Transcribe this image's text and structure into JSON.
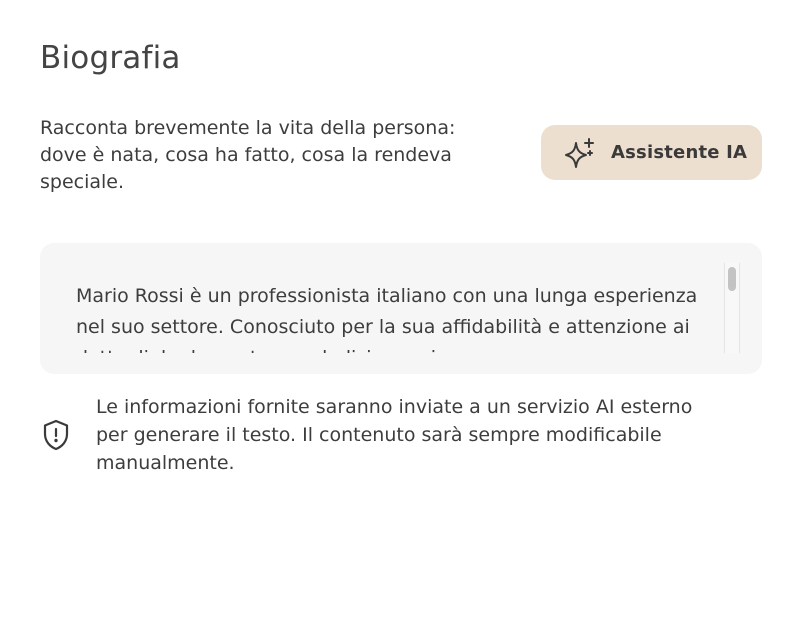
{
  "section": {
    "title": "Biografia",
    "description": "Racconta brevemente la vita della persona:\ndove è nata, cosa ha fatto, cosa la rendeva\nspeciale."
  },
  "ai_button": {
    "label": "Assistente IA",
    "icon": "sparkles-icon"
  },
  "biography_field": {
    "value": "Mario Rossi è un professionista italiano con una lunga esperienza nel suo settore. Conosciuto per la sua affidabilità e attenzione ai dettagli, ha lavorato con dedizione e impegno."
  },
  "notice": {
    "icon": "shield-alert-icon",
    "text": "Le informazioni fornite saranno inviate a un servizio AI esterno\nper generare il testo. Il contenuto sarà sempre modificabile\nmanualmente."
  }
}
